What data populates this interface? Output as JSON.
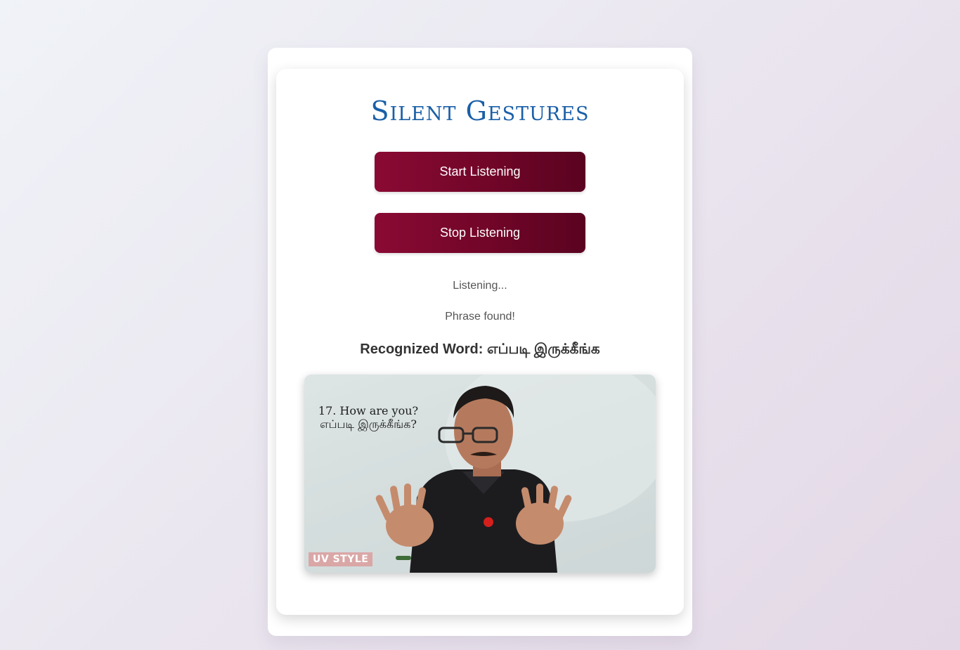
{
  "app": {
    "title": "Silent Gestures"
  },
  "controls": {
    "start_label": "Start Listening",
    "stop_label": "Stop Listening"
  },
  "status": {
    "listening": "Listening...",
    "phrase": "Phrase found!"
  },
  "recognized": {
    "text": "Recognized Word: எப்படி இருக்கீங்க"
  },
  "video": {
    "caption_line1": "17. How are you?",
    "caption_line2": "எப்படி இருக்கீங்க?",
    "watermark": "UV STYLE"
  },
  "colors": {
    "title": "#1a5fa8",
    "button": "#7a0730",
    "button_text": "#ffffff"
  }
}
